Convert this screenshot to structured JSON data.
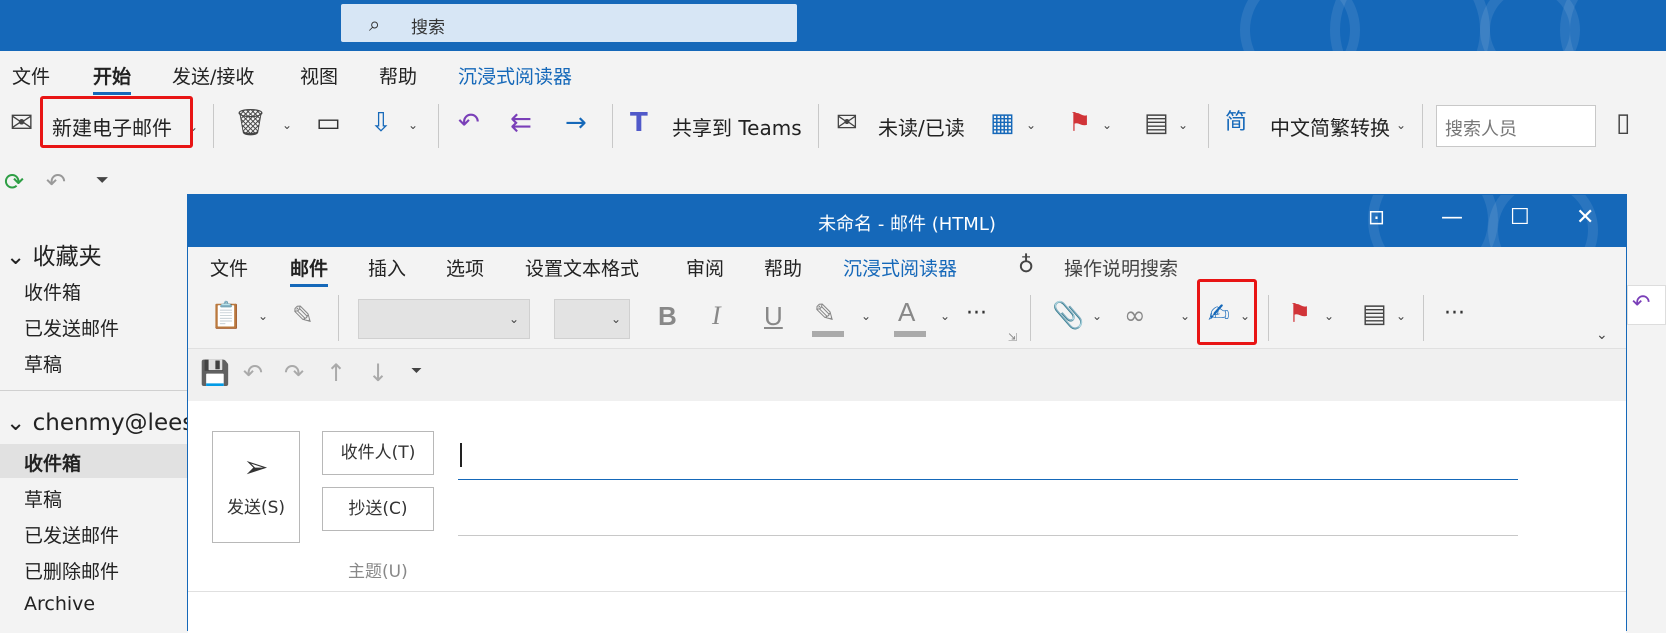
{
  "app": {
    "search_placeholder": "搜索",
    "menu": [
      "文件",
      "开始",
      "发送/接收",
      "视图",
      "帮助",
      "沉浸式阅读器"
    ],
    "ribbon": {
      "new_email": "新建电子邮件",
      "share_teams": "共享到 Teams",
      "unread_read": "未读/已读",
      "chinese_convert": "中文简繁转换",
      "search_people_placeholder": "搜索人员"
    }
  },
  "nav": {
    "favorites_header": "收藏夹",
    "favorites": [
      "收件箱",
      "已发送邮件",
      "草稿"
    ],
    "account_header": "chenmy@lees",
    "account_folders": [
      "收件箱",
      "草稿",
      "已发送邮件",
      "已删除邮件",
      "Archive"
    ],
    "selected_folder": "收件箱"
  },
  "compose": {
    "title": "未命名  -  邮件 (HTML)",
    "menu": [
      "文件",
      "邮件",
      "插入",
      "选项",
      "设置文本格式",
      "审阅",
      "帮助",
      "沉浸式阅读器"
    ],
    "tell_me": "操作说明搜索",
    "send": "发送(S)",
    "to_button": "收件人(T)",
    "cc_button": "抄送(C)",
    "subject_label": "主题(U)",
    "bold": "B",
    "italic": "I",
    "underline": "U",
    "font_color": "A",
    "more": "···"
  },
  "colors": {
    "accent": "#1568b9",
    "highlight_box": "#e81414"
  }
}
